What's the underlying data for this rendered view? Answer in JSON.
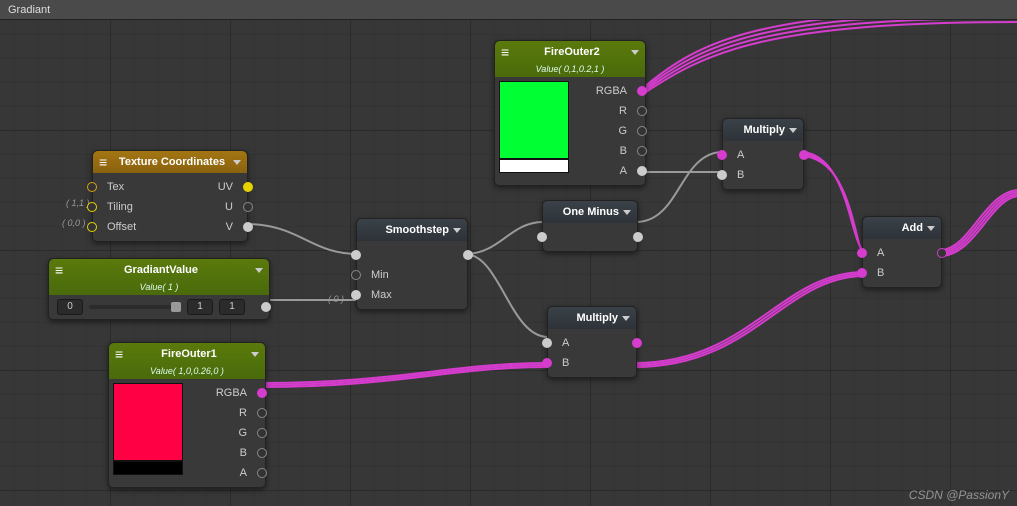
{
  "page_title": "Gradiant",
  "watermark": "CSDN @PassionY",
  "side_labels": {
    "tiling": "( 1,1 )",
    "offset": "( 0,0 )",
    "smoothstep_in": "( 0 )"
  },
  "nodes": {
    "texcoord": {
      "title": "Texture Coordinates",
      "rows": {
        "tex": "Tex",
        "uv": "UV",
        "tiling": "Tiling",
        "u": "U",
        "offset": "Offset",
        "v": "V"
      }
    },
    "gradiant_value": {
      "title": "GradiantValue",
      "subtitle": "Value( 1 )",
      "slider": {
        "min": "0",
        "max": "1",
        "val": "1"
      }
    },
    "fire_outer1": {
      "title": "FireOuter1",
      "subtitle": "Value( 1,0,0.26,0 )",
      "rows": {
        "rgba": "RGBA",
        "r": "R",
        "g": "G",
        "b": "B",
        "a": "A"
      },
      "color": "#ff0044"
    },
    "fire_outer2": {
      "title": "FireOuter2",
      "subtitle": "Value( 0,1,0.2,1 )",
      "rows": {
        "rgba": "RGBA",
        "r": "R",
        "g": "G",
        "b": "B",
        "a": "A"
      },
      "color": "#00ff33"
    },
    "smoothstep": {
      "title": "Smoothstep",
      "rows": {
        "min": "Min",
        "max": "Max"
      }
    },
    "one_minus": {
      "title": "One Minus"
    },
    "multiply1": {
      "title": "Multiply",
      "rows": {
        "a": "A",
        "b": "B"
      }
    },
    "multiply2": {
      "title": "Multiply",
      "rows": {
        "a": "A",
        "b": "B"
      }
    },
    "add": {
      "title": "Add",
      "rows": {
        "a": "A",
        "b": "B"
      }
    }
  }
}
